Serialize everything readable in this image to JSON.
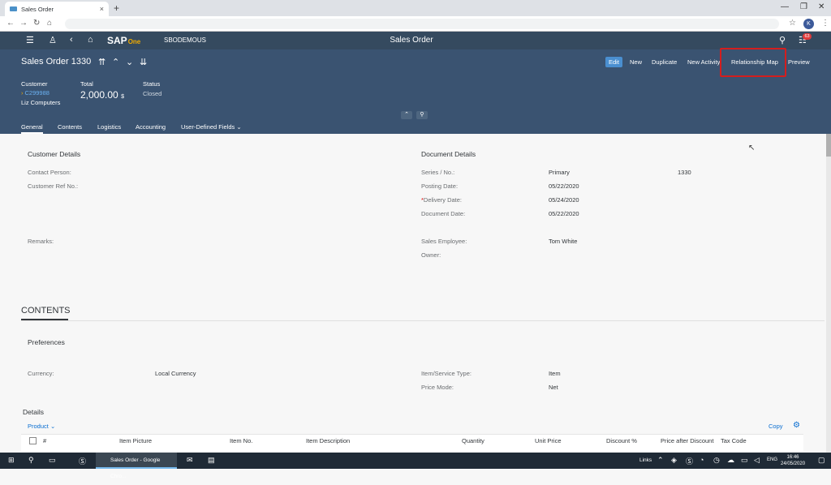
{
  "browser": {
    "tab_title": "Sales Order",
    "url": ""
  },
  "shell": {
    "logo_sap": "SAP",
    "logo_business": "Business",
    "logo_one": "One",
    "company": "SBODEMOUS",
    "app_title": "Sales Order",
    "notification_count": "63"
  },
  "object": {
    "title": "Sales Order 1330"
  },
  "actions": {
    "edit": "Edit",
    "new": "New",
    "duplicate": "Duplicate",
    "new_activity": "New Activity",
    "relationship_map": "Relationship Map",
    "preview": "Preview"
  },
  "kpis": {
    "customer_label": "Customer",
    "customer_code": "C299988",
    "customer_name": "Liz Computers",
    "total_label": "Total",
    "total_value": "2,000.00",
    "total_currency": "$",
    "status_label": "Status",
    "status_value": "Closed"
  },
  "tabs": {
    "general": "General",
    "contents": "Contents",
    "logistics": "Logistics",
    "accounting": "Accounting",
    "udf": "User-Defined Fields"
  },
  "customer_details": {
    "title": "Customer Details",
    "contact_person": "Contact Person:",
    "customer_ref": "Customer Ref No.:",
    "remarks": "Remarks:"
  },
  "document_details": {
    "title": "Document Details",
    "series_label": "Series / No.:",
    "series_value": "Primary",
    "series_no": "1330",
    "posting_label": "Posting Date:",
    "posting_value": "05/22/2020",
    "delivery_label": "Delivery Date:",
    "delivery_value": "05/24/2020",
    "document_label": "Document Date:",
    "document_value": "05/22/2020",
    "sales_emp_label": "Sales Employee:",
    "sales_emp_value": "Tom White",
    "owner_label": "Owner:"
  },
  "contents": {
    "title": "CONTENTS",
    "preferences": "Preferences",
    "currency_label": "Currency:",
    "currency_value": "Local Currency",
    "item_type_label": "Item/Service Type:",
    "item_type_value": "Item",
    "price_mode_label": "Price Mode:",
    "price_mode_value": "Net",
    "details": "Details",
    "product": "Product",
    "copy": "Copy"
  },
  "table_headers": [
    "#",
    "Item Picture",
    "Item No.",
    "Item Description",
    "Quantity",
    "Unit Price",
    "Discount %",
    "Price after Discount",
    "Tax Code"
  ],
  "taskbar": {
    "task_label": "Sales Order - Google Chro...",
    "links": "Links",
    "lang": "ENG",
    "time": "16:46",
    "date": "24/05/2020"
  }
}
